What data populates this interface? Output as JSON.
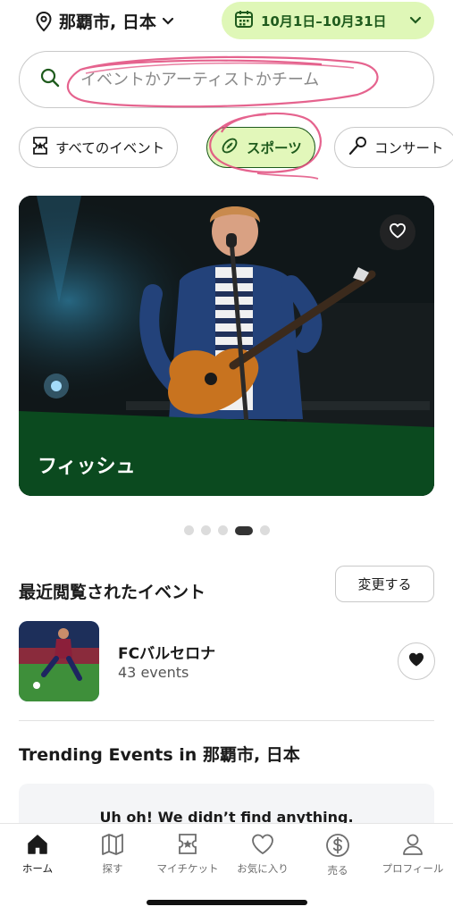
{
  "header": {
    "location": "那覇市, 日本",
    "date_range": "10月1日–10月31日"
  },
  "search": {
    "placeholder": "イベントかアーティストかチーム"
  },
  "chips": [
    {
      "label": "すべてのイベント",
      "icon": "ticket-star-icon",
      "active": false
    },
    {
      "label": "スポーツ",
      "icon": "football-icon",
      "active": true
    },
    {
      "label": "コンサート",
      "icon": "microphone-icon",
      "active": false
    }
  ],
  "hero": {
    "title": "フィッシュ",
    "carousel_total": 5,
    "carousel_active_index": 3
  },
  "recently_viewed": {
    "title": "最近閲覧されたイベント",
    "change_label": "変更する",
    "items": [
      {
        "name": "FCバルセロナ",
        "count": "43 events"
      }
    ]
  },
  "trending": {
    "title": "Trending Events in 那覇市, 日本",
    "empty_message": "Uh oh! We didn’t find anything."
  },
  "tabbar": [
    {
      "label": "ホーム",
      "icon": "home-icon",
      "active": true
    },
    {
      "label": "探す",
      "icon": "map-icon",
      "active": false
    },
    {
      "label": "マイチケット",
      "icon": "ticket-star-icon",
      "active": false
    },
    {
      "label": "お気に入り",
      "icon": "heart-icon",
      "active": false
    },
    {
      "label": "売る",
      "icon": "dollar-circle-icon",
      "active": false
    },
    {
      "label": "プロフィール",
      "icon": "person-icon",
      "active": false
    }
  ],
  "colors": {
    "accent_green": "#1f5b1d",
    "pill_green": "#dff7b7",
    "hero_band": "#0b4a1f",
    "annotation_pink": "#e0487a"
  }
}
